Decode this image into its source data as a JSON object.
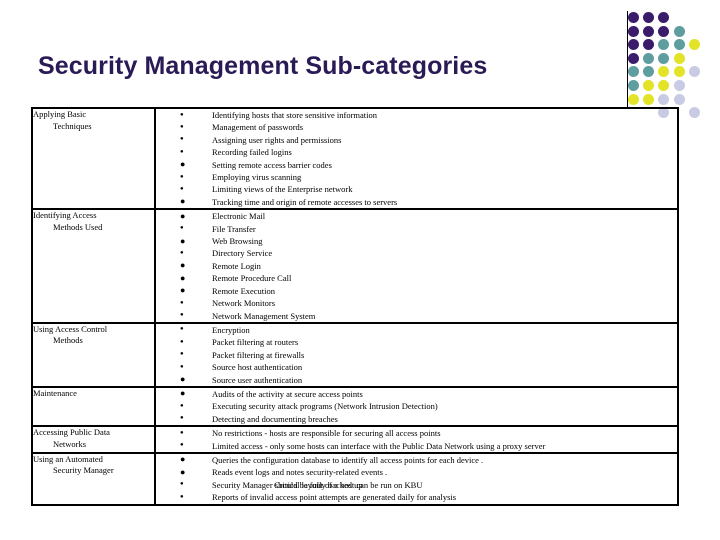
{
  "slide": {
    "title": "Security Management Sub-categories",
    "title_color": "#2A1A55"
  },
  "decor": {
    "name": "dot-matrix-decoration",
    "colors": {
      "purple": "#3B1C6B",
      "teal": "#5E9DA0",
      "yellow": "#E3E327",
      "lavender": "#C9CAE4"
    },
    "dots": [
      {
        "row": 0,
        "col": 0,
        "color": "#3B1C6B"
      },
      {
        "row": 0,
        "col": 1,
        "color": "#3B1C6B"
      },
      {
        "row": 0,
        "col": 2,
        "color": "#3B1C6B"
      },
      {
        "row": 1,
        "col": 0,
        "color": "#3B1C6B"
      },
      {
        "row": 1,
        "col": 1,
        "color": "#3B1C6B"
      },
      {
        "row": 1,
        "col": 2,
        "color": "#3B1C6B"
      },
      {
        "row": 1,
        "col": 3,
        "color": "#5E9DA0"
      },
      {
        "row": 2,
        "col": 0,
        "color": "#3B1C6B"
      },
      {
        "row": 2,
        "col": 1,
        "color": "#3B1C6B"
      },
      {
        "row": 2,
        "col": 2,
        "color": "#5E9DA0"
      },
      {
        "row": 2,
        "col": 3,
        "color": "#5E9DA0"
      },
      {
        "row": 2,
        "col": 4,
        "color": "#E3E327"
      },
      {
        "row": 3,
        "col": 0,
        "color": "#3B1C6B"
      },
      {
        "row": 3,
        "col": 1,
        "color": "#5E9DA0"
      },
      {
        "row": 3,
        "col": 2,
        "color": "#5E9DA0"
      },
      {
        "row": 3,
        "col": 3,
        "color": "#E3E327"
      },
      {
        "row": 4,
        "col": 0,
        "color": "#5E9DA0"
      },
      {
        "row": 4,
        "col": 1,
        "color": "#5E9DA0"
      },
      {
        "row": 4,
        "col": 2,
        "color": "#E3E327"
      },
      {
        "row": 4,
        "col": 3,
        "color": "#E3E327"
      },
      {
        "row": 4,
        "col": 4,
        "color": "#C9CAE4"
      },
      {
        "row": 5,
        "col": 0,
        "color": "#5E9DA0"
      },
      {
        "row": 5,
        "col": 1,
        "color": "#E3E327"
      },
      {
        "row": 5,
        "col": 2,
        "color": "#E3E327"
      },
      {
        "row": 5,
        "col": 3,
        "color": "#C9CAE4"
      },
      {
        "row": 6,
        "col": 0,
        "color": "#E3E327"
      },
      {
        "row": 6,
        "col": 1,
        "color": "#E3E327"
      },
      {
        "row": 6,
        "col": 2,
        "color": "#C9CAE4"
      },
      {
        "row": 6,
        "col": 3,
        "color": "#C9CAE4"
      },
      {
        "row": 7,
        "col": 2,
        "color": "#C9CAE4"
      },
      {
        "row": 7,
        "col": 4,
        "color": "#C9CAE4"
      }
    ]
  },
  "table": {
    "rows": [
      {
        "category_line1": "Applying Basic",
        "category_line2": "Techniques",
        "items": [
          {
            "bullet": "sm",
            "text": "Identifying hosts that store sensitive information"
          },
          {
            "bullet": "sm",
            "text": "Management of passwords"
          },
          {
            "bullet": "sm",
            "text": "Assigning user rights and permissions"
          },
          {
            "bullet": "sm",
            "text": "Recording failed logins"
          },
          {
            "bullet": "lg",
            "text": "Setting remote access barrier codes"
          },
          {
            "bullet": "sm",
            "text": "Employing virus scanning"
          },
          {
            "bullet": "sm",
            "text": "Limiting views of the Enterprise network"
          },
          {
            "bullet": "lg",
            "text": "Tracking time and origin of remote accesses to servers"
          }
        ]
      },
      {
        "category_line1": "Identifying Access",
        "category_line2": "Methods Used",
        "items": [
          {
            "bullet": "lg",
            "text": "Electronic Mail"
          },
          {
            "bullet": "sm",
            "text": "File Transfer"
          },
          {
            "bullet": "lg",
            "text": "Web Browsing"
          },
          {
            "bullet": "sm",
            "text": "Directory Service"
          },
          {
            "bullet": "lg",
            "text": "Remote Login"
          },
          {
            "bullet": "lg",
            "text": "Remote Procedure Call"
          },
          {
            "bullet": "lg",
            "text": "Remote Execution"
          },
          {
            "bullet": "sm",
            "text": "Network Monitors"
          },
          {
            "bullet": "sm",
            "text": "Network Management System"
          }
        ]
      },
      {
        "category_line1": "Using Access Control",
        "category_line2": "Methods",
        "items": [
          {
            "bullet": "sm",
            "text": "Encryption"
          },
          {
            "bullet": "sm",
            "text": "Packet filtering at routers"
          },
          {
            "bullet": "sm",
            "text": "Packet filtering at firewalls"
          },
          {
            "bullet": "sm",
            "text": "Source host authentication"
          },
          {
            "bullet": "lg",
            "text": "Source user authentication"
          }
        ]
      },
      {
        "category_line1": "Maintenance",
        "category_line2": "",
        "items": [
          {
            "bullet": "lg",
            "text": "Audits of the activity at secure access points"
          },
          {
            "bullet": "sm",
            "text": "Executing security attack programs (Network Intrusion Detection)"
          },
          {
            "bullet": "sm",
            "text": "Detecting and documenting breaches"
          }
        ]
      },
      {
        "category_line1": "Accessing Public Data",
        "category_line2": "Networks",
        "items": [
          {
            "bullet": "sm",
            "text": "No restrictions - hosts are responsible for securing all access points"
          },
          {
            "bullet": "sm",
            "text": "Limited access - only some hosts can interface with the Public Data Network using a proxy server"
          }
        ]
      },
      {
        "category_line1": "Using an Automated",
        "category_line2": "Security Manager",
        "items": [
          {
            "bullet": "lg",
            "text": "Queries the configuration database to identify all access points for each device ."
          },
          {
            "bullet": "lg",
            "text": "Reads event logs and notes security-related events ."
          },
          {
            "bullet": "sm",
            "text": "Security Manager should be fully backed up",
            "overlap_text": "Critical layout of a host can be run on KBU"
          },
          {
            "bullet": "sm",
            "text": "Reports of  invalid access point attempts are generated daily for analysis"
          }
        ]
      }
    ]
  }
}
